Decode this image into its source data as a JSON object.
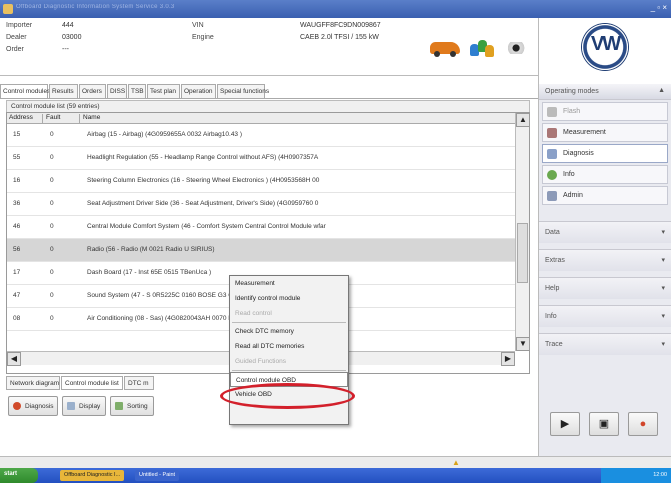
{
  "titlebar": {
    "title": "Offboard Diagnostic Information System Service 3.0.3",
    "window_controls": "_ ▫ ×"
  },
  "header": {
    "importer_label": "Importer",
    "importer_value": "444",
    "dealer_label": "Dealer",
    "dealer_value": "03000",
    "order_label": "Order",
    "order_value": "---",
    "vin_label": "VIN",
    "vin_value": "WAUGFF8FC9DN009867",
    "engine_label": "Engine",
    "engine_value": "CAEB 2.0l TFSI / 155 kW"
  },
  "tabs": [
    "Control modules",
    "Results",
    "Orders",
    "DISS",
    "TSB",
    "Test plan",
    "Operation",
    "Special functions"
  ],
  "list": {
    "caption": "Control module list (59 entries)",
    "columns": [
      "Address",
      "Fault",
      "Name"
    ],
    "rows": [
      {
        "address": "15",
        "fault": "0",
        "name": "Airbag (15 - Airbag) (4G0959655A   0032   Airbag10.43  )"
      },
      {
        "address": "55",
        "fault": "0",
        "name": "Headlight Regulation (55 - Headlamp Range Control without AFS) (4H0907357A"
      },
      {
        "address": "16",
        "fault": "0",
        "name": "Steering Column Electronics (16 - Steering Wheel Electronics ) (4H0953568H   00"
      },
      {
        "address": "36",
        "fault": "0",
        "name": "Seat Adjustment Driver Side (36 - Seat Adjustment, Driver's Side) (4G0959760   0"
      },
      {
        "address": "46",
        "fault": "0",
        "name": "Central Module Comfort System (46 - Comfort System Central Control Module wfar"
      },
      {
        "address": "56",
        "fault": "0",
        "name": "Radio (56 - Radio (M                          0021   Radio U SIRIUS)"
      },
      {
        "address": "17",
        "fault": "0",
        "name": "Dash Board (17 - Inst                              65E   0515   TBenUca   )"
      },
      {
        "address": "47",
        "fault": "0",
        "name": "Sound System (47 - S                             0R5225C   0160   BOSE G3 C7"
      },
      {
        "address": "08",
        "fault": "0",
        "name": "Air Conditioning (08 -                          Sas) (4G0820043AH   0070   KL"
      }
    ],
    "selected_index": 5
  },
  "context_menu": {
    "items": [
      {
        "label": "Measurement",
        "enabled": true
      },
      {
        "label": "Identify control module",
        "enabled": true
      },
      {
        "label": "Read control",
        "enabled": false
      },
      {
        "label": "Check DTC memory",
        "enabled": true
      },
      {
        "label": "Read all DTC memories",
        "enabled": true
      },
      {
        "label": "Guided Functions",
        "enabled": false
      },
      {
        "label": "Control module OBD",
        "enabled": true
      },
      {
        "label": "Vehicle OBD",
        "enabled": true
      }
    ],
    "highlighted": "Control module OBD"
  },
  "bottom_tabs": [
    "Network diagram",
    "Control module list",
    "DTC m"
  ],
  "buttons": {
    "diagnosis": "Diagnosis",
    "display": "Display",
    "sorting": "Sorting"
  },
  "side": {
    "operating_modes": "Operating modes",
    "items": [
      {
        "label": "Flash",
        "icon": "flash-icon",
        "dim": true
      },
      {
        "label": "Measurement",
        "icon": "measurement-icon",
        "dim": false
      },
      {
        "label": "Diagnosis",
        "icon": "diagnosis-icon",
        "dim": false,
        "active": true
      },
      {
        "label": "Info",
        "icon": "info-icon",
        "dim": false
      },
      {
        "label": "Admin",
        "icon": "admin-icon",
        "dim": false
      }
    ],
    "groups": [
      "Data",
      "Extras",
      "Help",
      "Info",
      "Trace"
    ],
    "brand_logo": "VW"
  },
  "taskbar": {
    "start": "start",
    "apps": [
      "Offboard Diagnostic I...",
      "Untitled - Paint"
    ],
    "tray": "12:00"
  },
  "colors": {
    "accent_red": "#d3202b",
    "titlebar": "#3a5fb0",
    "selection": "#d6d6d6"
  }
}
